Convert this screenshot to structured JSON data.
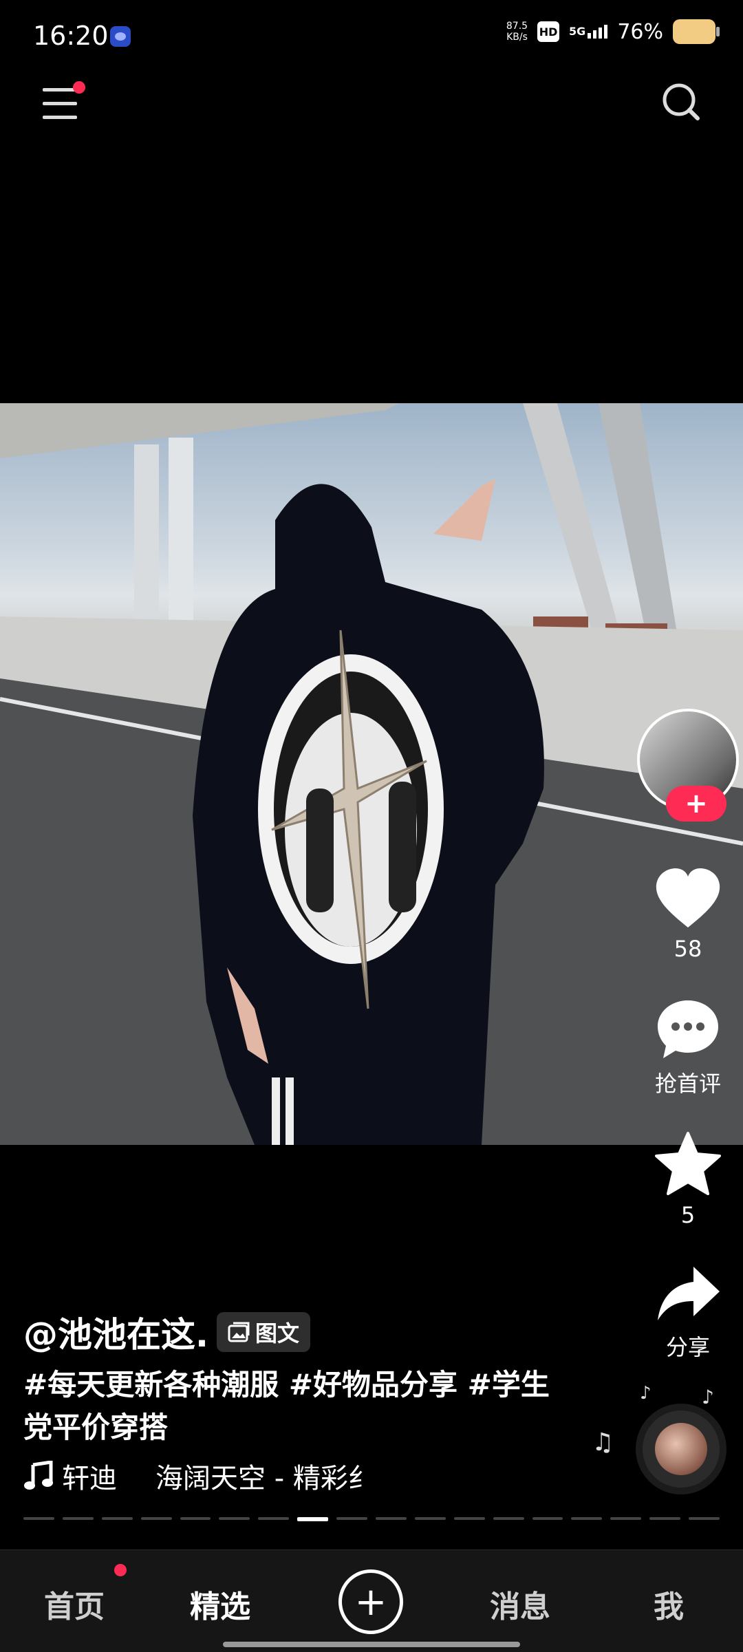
{
  "status_bar": {
    "time": "16:20",
    "net_speed_value": "87.5",
    "net_speed_unit": "KB/s",
    "hd": "HD",
    "network": "5G",
    "battery": "76%"
  },
  "post": {
    "author": "@池池在这.",
    "type_badge": "图文",
    "description": "#每天更新各种潮服 #好物品分享 #学生党平价穿搭",
    "music_artist": "轩迪",
    "music_title": "海阔天空 - 精彩纟",
    "progress": {
      "segments": 18,
      "current": 8
    }
  },
  "actions": {
    "follow": "+",
    "likes": "58",
    "comment": "抢首评",
    "favorites": "5",
    "share": "分享"
  },
  "tabbar": {
    "home": "首页",
    "featured": "精选",
    "create": "+",
    "messages": "消息",
    "me": "我"
  },
  "colors": {
    "accent": "#fe2c55",
    "background": "#000000",
    "tabbar": "#161616"
  }
}
